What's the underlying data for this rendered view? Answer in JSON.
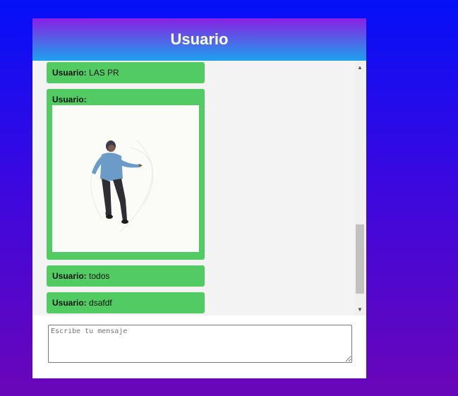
{
  "header": {
    "title": "Usuario"
  },
  "messages": [
    {
      "sender": "Usuario:",
      "text": "LAS PR",
      "type": "text"
    },
    {
      "sender": "Usuario:",
      "text": "",
      "type": "image",
      "image_icon": "dancing-man-gif"
    },
    {
      "sender": "Usuario:",
      "text": "todos",
      "type": "text"
    },
    {
      "sender": "Usuario:",
      "text": "dsafdf",
      "type": "text"
    }
  ],
  "composer": {
    "placeholder": "Escribe tu mensaje",
    "value": ""
  },
  "colors": {
    "message_bubble": "#52cc62",
    "header_top": "#8a1fe2",
    "header_bottom": "#1da2ee",
    "background_top": "#0410f8",
    "background_bottom": "#6a06b8"
  }
}
